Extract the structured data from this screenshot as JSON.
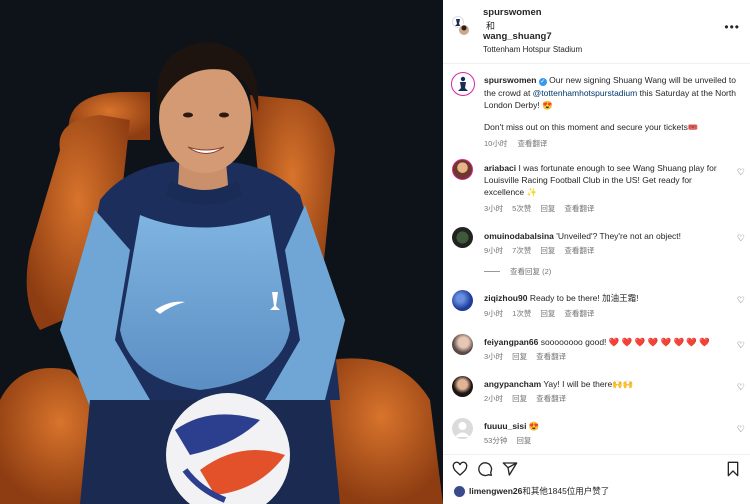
{
  "header": {
    "user1": "spurswomen",
    "and": "和",
    "user2": "wang_shuang7",
    "location": "Tottenham Hotspur Stadium"
  },
  "caption": {
    "username": "spurswomen",
    "text_part1": " Our new signing Shuang Wang will be unveiled to the crowd at ",
    "mention": "@tottenhamhotspurstadium",
    "text_part2": " this Saturday at the North London Derby! ",
    "emoji": "😍",
    "line2": "Don't miss out on this moment and secure your tickets",
    "line2_emoji": "🎟️",
    "time": "10小时",
    "translate": "查看翻译"
  },
  "comments": [
    {
      "username": "ariabaci",
      "text": "I was fortunate enough to see Wang Shuang play for Louisville Racing Football Club in the US! Get ready for excellence ✨",
      "time": "3小时",
      "likes": "5次赞",
      "reply": "回复",
      "translate": "查看翻译"
    },
    {
      "username": "omuinodabalsina",
      "text": "'Unveiled'? They're not an object!",
      "time": "9小时",
      "likes": "7次赞",
      "reply": "回复",
      "translate": "查看翻译",
      "view_replies": "查看回复 (2)"
    },
    {
      "username": "ziqizhou90",
      "text": "Ready to be there! 加油王霜!",
      "time": "9小时",
      "likes": "1次赞",
      "reply": "回复",
      "translate": "查看翻译"
    },
    {
      "username": "feiyangpan66",
      "text": "soooooooo good! ❤️ ❤️ ❤️ ❤️ ❤️ ❤️ ❤️ ❤️",
      "time": "3小时",
      "reply": "回复",
      "translate": "查看翻译"
    },
    {
      "username": "angypancham",
      "text": "Yay! I will be there🙌🙌",
      "time": "2小时",
      "reply": "回复",
      "translate": "查看翻译"
    },
    {
      "username": "fuuuu_sisi",
      "text": "😍",
      "time": "53分钟",
      "reply": "回复"
    }
  ],
  "likes_bar": {
    "user": "limengwen26",
    "text": "和其他1845位用户赞了"
  },
  "icons": [
    "heart-icon",
    "comment-icon",
    "share-icon",
    "bookmark-icon",
    "more-options-icon"
  ]
}
